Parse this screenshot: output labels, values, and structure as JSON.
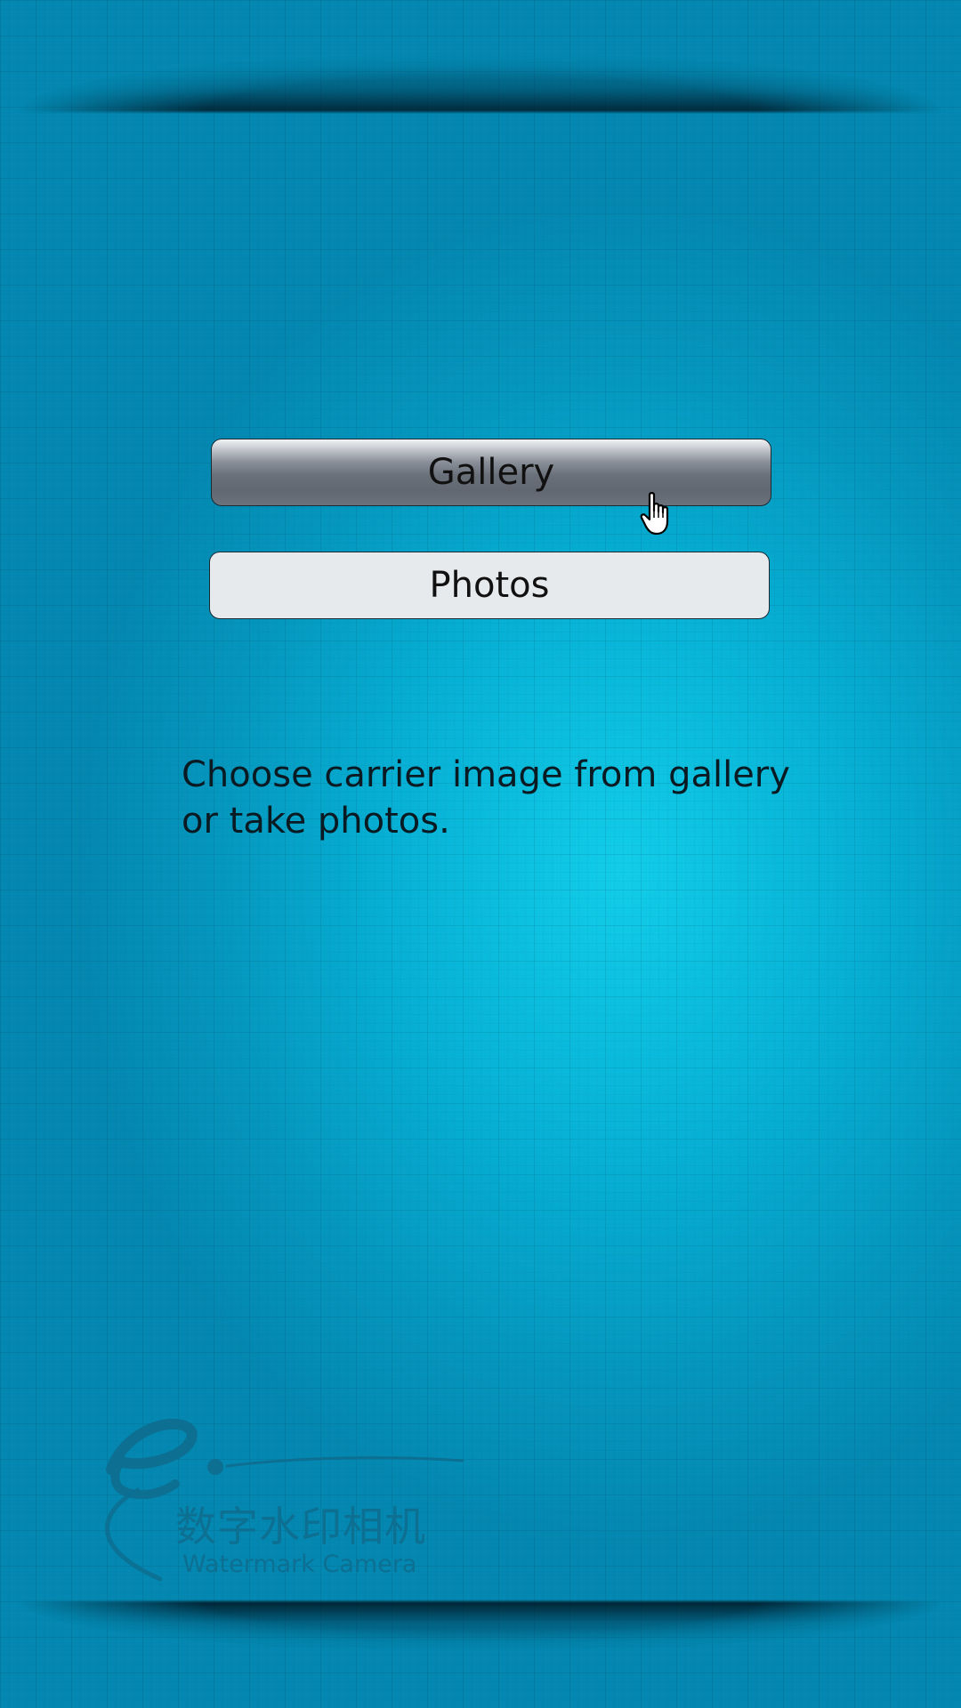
{
  "buttons": {
    "gallery_label": "Gallery",
    "photos_label": "Photos"
  },
  "hint": {
    "line1": "Choose carrier image from gallery",
    "line2": "or take photos."
  },
  "logo": {
    "chinese_name": "数字水印相机",
    "english_name": "Watermark Camera"
  },
  "colors": {
    "background": "#07b2d6",
    "gallery_button_gradient_mid": "#6a7079",
    "photos_button_bg": "#e6eaec",
    "logo_text": "#0d6f92"
  },
  "icons": {
    "cursor": "hand-pointer-icon",
    "logo_mark": "e-logo-icon"
  }
}
